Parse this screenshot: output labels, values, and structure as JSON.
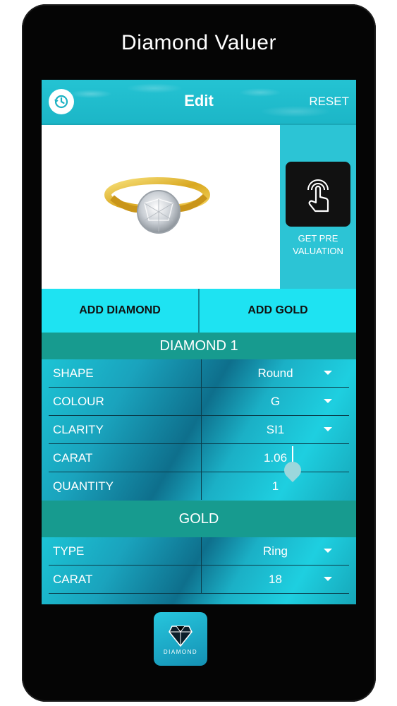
{
  "phone_title": "Diamond Valuer",
  "topbar": {
    "title": "Edit",
    "reset": "RESET",
    "history_icon": "history-icon"
  },
  "side_panel": {
    "pre_valuation": "GET PRE VALUATION",
    "icon": "touch-icon"
  },
  "actions": {
    "add_diamond": "ADD DIAMOND",
    "add_gold": "ADD GOLD"
  },
  "diamond": {
    "heading": "DIAMOND 1",
    "rows": [
      {
        "label": "SHAPE",
        "value": "Round"
      },
      {
        "label": "COLOUR",
        "value": "G"
      },
      {
        "label": "CLARITY",
        "value": "SI1"
      },
      {
        "label": "CARAT",
        "value": "1.06"
      },
      {
        "label": "QUANTITY",
        "value": "1"
      }
    ]
  },
  "gold": {
    "heading": "GOLD",
    "rows": [
      {
        "label": "TYPE",
        "value": "Ring"
      },
      {
        "label": "CARAT",
        "value": "18"
      }
    ]
  },
  "app_icon": {
    "label": "DIAMOND"
  },
  "colors": {
    "accent": "#1ee3f2",
    "section": "#179b8f",
    "phone": "#050505"
  }
}
